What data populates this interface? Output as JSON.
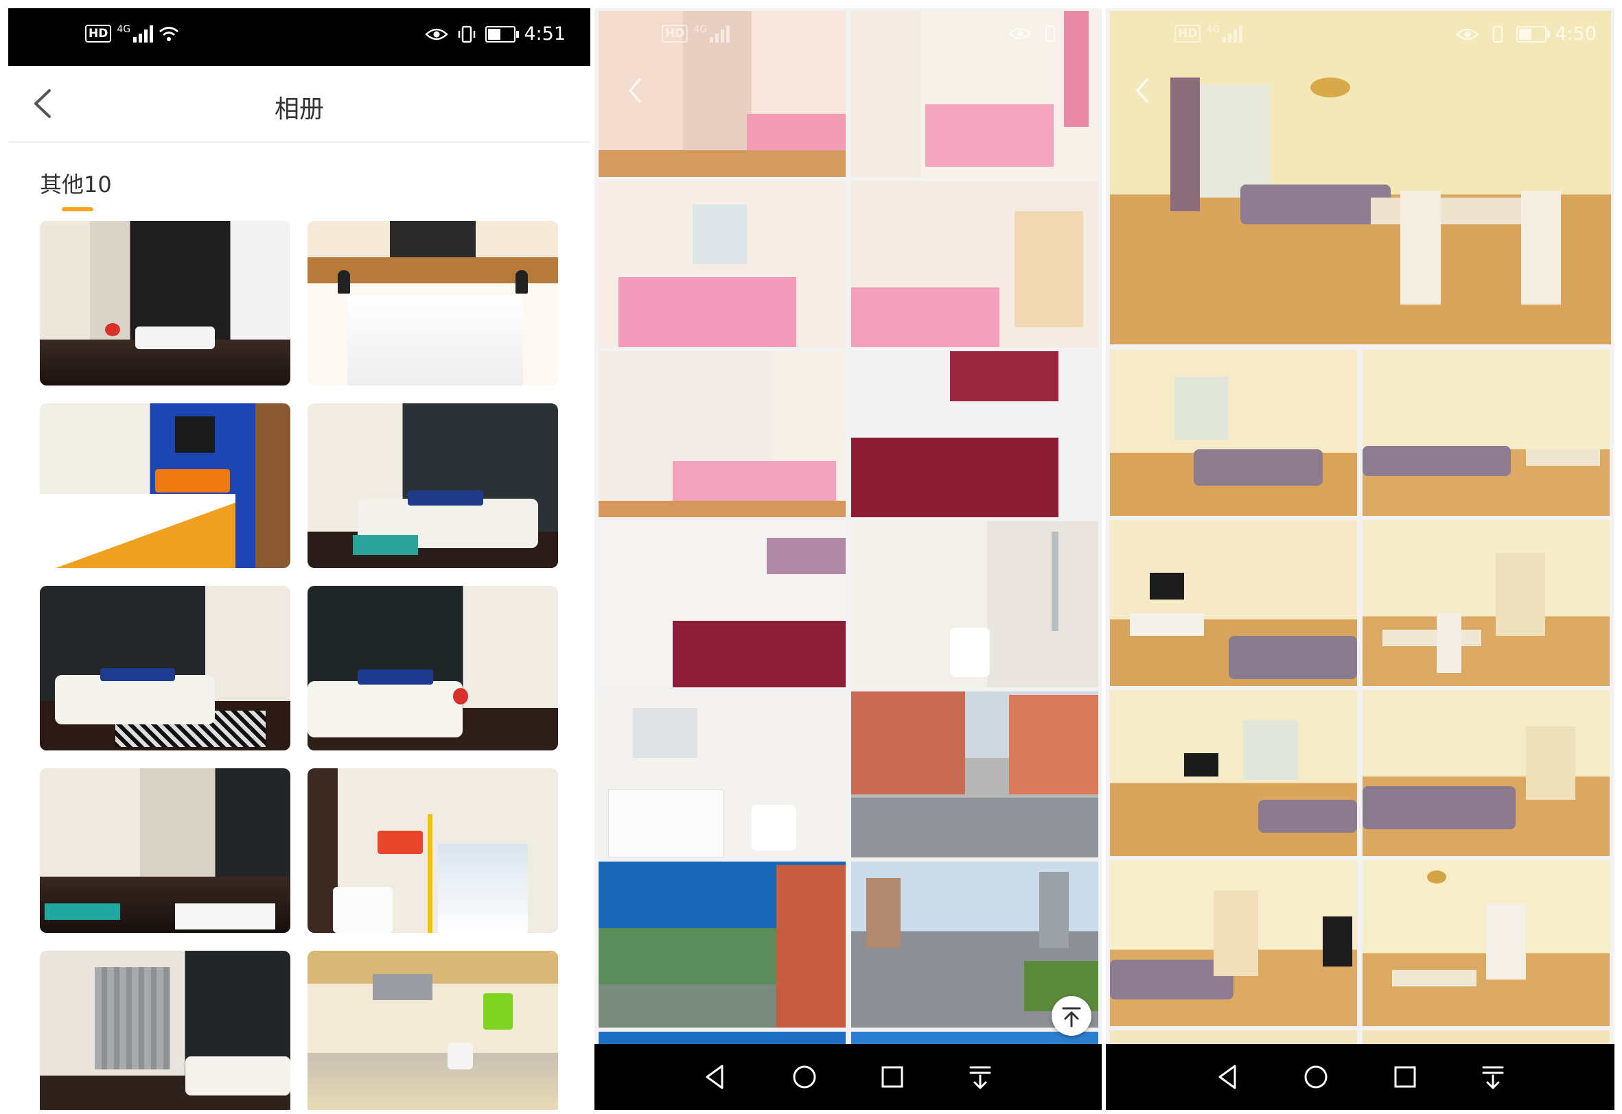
{
  "panel_album": {
    "status": {
      "time": "4:51",
      "network": "4G",
      "hd": "HD",
      "battery_level": 0.45
    },
    "header": {
      "title": "相册",
      "back_icon": "chevron-left-icon"
    },
    "section": {
      "label": "其他10"
    },
    "accent_color": "#f5a623",
    "photos": [
      {
        "scene": "living-room-dark-wall"
      },
      {
        "scene": "white-bedroom"
      },
      {
        "scene": "bedroom-blue-wall-orange-pillows"
      },
      {
        "scene": "living-room-sofa-table"
      },
      {
        "scene": "living-room-black-wall-sofa"
      },
      {
        "scene": "living-room-sofa-dining"
      },
      {
        "scene": "living-room-hallway-tv"
      },
      {
        "scene": "bathroom-washing-machine"
      },
      {
        "scene": "living-room-window-tv"
      },
      {
        "scene": "kitchen-yellow"
      }
    ]
  },
  "panel_pink": {
    "status": {
      "time": "",
      "network": "4G",
      "hd": "HD",
      "battery_level": 0.45
    },
    "back_icon": "chevron-left-icon",
    "scroll_top_icon": "arrow-up-to-top-icon",
    "nav": [
      "back-triangle-icon",
      "home-circle-icon",
      "recents-square-icon",
      "notification-pull-icon"
    ],
    "photos": [
      {
        "scene": "pink-bedroom-desk"
      },
      {
        "scene": "pink-bedroom-wardrobe"
      },
      {
        "scene": "pink-bedroom-ac"
      },
      {
        "scene": "pink-bedroom-door"
      },
      {
        "scene": "pink-bedroom-closet"
      },
      {
        "scene": "kitchen-red-cabinets"
      },
      {
        "scene": "kitchen-red-cabinets-2"
      },
      {
        "scene": "bathroom-shower"
      },
      {
        "scene": "bathroom-vanity"
      },
      {
        "scene": "street-view"
      },
      {
        "scene": "city-skyline"
      },
      {
        "scene": "city-road"
      },
      {
        "scene": "partial-blue-sky"
      },
      {
        "scene": "partial-blue-sky-2"
      }
    ]
  },
  "panel_yellow": {
    "status": {
      "time": "4:50",
      "network": "4G",
      "hd": "HD",
      "battery_level": 0.45
    },
    "back_icon": "chevron-left-icon",
    "nav": [
      "back-triangle-icon",
      "home-circle-icon",
      "recents-square-icon",
      "notification-pull-icon"
    ],
    "photos": [
      {
        "scene": "living-dining-wide"
      },
      {
        "scene": "living-room-sofa"
      },
      {
        "scene": "living-room-dining"
      },
      {
        "scene": "living-room-tv"
      },
      {
        "scene": "dining-hallway"
      },
      {
        "scene": "living-room-window"
      },
      {
        "scene": "living-room-sofa-2"
      },
      {
        "scene": "sofa-hallway"
      },
      {
        "scene": "dining-hallway-2"
      },
      {
        "scene": "partial-row"
      },
      {
        "scene": "partial-row-2"
      }
    ]
  }
}
